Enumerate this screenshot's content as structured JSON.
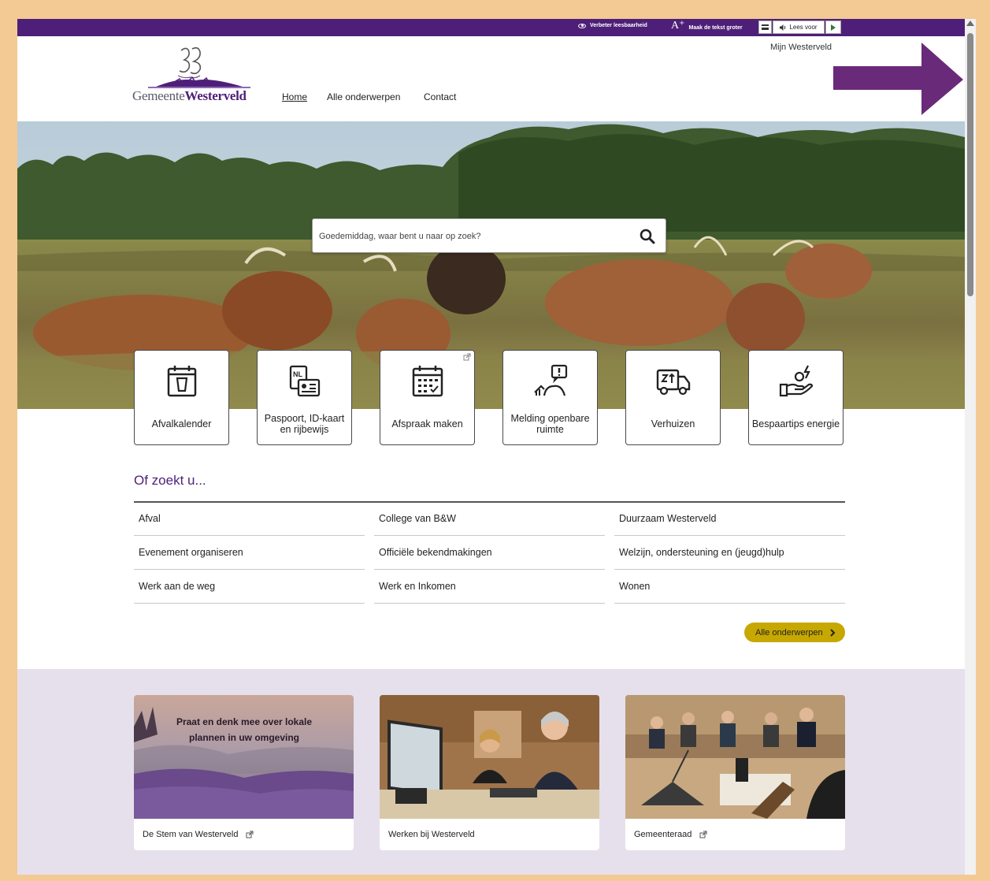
{
  "topbar": {
    "readability_label": "Verbeter leesbaarheid",
    "text_larger_glyph": "A⁺",
    "text_larger_label": "Maak de tekst groter",
    "listen_label": "Lees voor"
  },
  "header": {
    "mijn_link": "Mijn Westerveld",
    "logo_text_regular": "Gemeente",
    "logo_text_bold": "Westerveld"
  },
  "nav": {
    "home": "Home",
    "all_topics": "Alle onderwerpen",
    "contact": "Contact"
  },
  "search": {
    "placeholder": "Goedemiddag, waar bent u naar op zoek?"
  },
  "tiles": [
    {
      "label": "Afvalkalender",
      "icon": "waste-calendar-icon"
    },
    {
      "label": "Paspoort, ID-kaart en rijbewijs",
      "icon": "id-card-icon"
    },
    {
      "label": "Afspraak maken",
      "icon": "calendar-icon",
      "external": true
    },
    {
      "label": "Melding openbare ruimte",
      "icon": "report-icon"
    },
    {
      "label": "Verhuizen",
      "icon": "moving-truck-icon"
    },
    {
      "label": "Bespaartips energie",
      "icon": "energy-saving-icon"
    }
  ],
  "or_search": {
    "title": "Of zoekt u...",
    "items": [
      "Afval",
      "College van B&W",
      "Duurzaam Westerveld",
      "Evenement organiseren",
      "Officiële bekendmakingen",
      "Welzijn, ondersteuning en (jeugd)hulp",
      "Werk aan de weg",
      "Werk en Inkomen",
      "Wonen"
    ],
    "all_button": "Alle onderwerpen"
  },
  "cards": [
    {
      "label": "De Stem van Westerveld",
      "overlay_text_1": "Praat en denk mee over lokale",
      "overlay_text_2": "plannen in uw omgeving",
      "external": true
    },
    {
      "label": "Werken bij Westerveld",
      "external": false
    },
    {
      "label": "Gemeenteraad",
      "external": true
    }
  ],
  "colors": {
    "brand_purple": "#4e1f78",
    "accent_yellow": "#c7a800",
    "annotation_arrow": "#6a2a7a",
    "frame": "#f3c994"
  }
}
